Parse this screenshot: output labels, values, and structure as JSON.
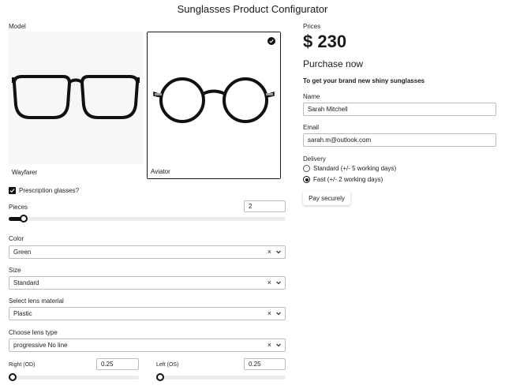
{
  "title": "Sunglasses Product Configurator",
  "model": {
    "label": "Model",
    "options": [
      {
        "name": "Wayfarer",
        "selected": false
      },
      {
        "name": "Aviator",
        "selected": true
      }
    ]
  },
  "prescription": {
    "label": "Prescription glasses?",
    "checked": true
  },
  "pieces": {
    "label": "Pieces",
    "value": "2",
    "slider_fraction": 0.05
  },
  "color": {
    "label": "Color",
    "value": "Green"
  },
  "size": {
    "label": "Size",
    "value": "Standard"
  },
  "lens_material": {
    "label": "Select lens material",
    "value": "Plastic"
  },
  "lens_type": {
    "label": "Choose lens type",
    "value": "progressive No line"
  },
  "right_od": {
    "label": "Right (OD)",
    "value": "0.25",
    "slider_fraction": 0.0
  },
  "left_os": {
    "label": "Left (OS)",
    "value": "0.25",
    "slider_fraction": 0.0
  },
  "prices": {
    "label": "Prices",
    "value": "$ 230"
  },
  "purchase": {
    "heading": "Purchase now",
    "subtitle": "To get your brand new shiny sunglasses"
  },
  "name": {
    "label": "Name",
    "value": "Sarah Mitchell"
  },
  "email": {
    "label": "Email",
    "value": "sarah.m@outlook.com"
  },
  "delivery": {
    "label": "Delivery",
    "options": [
      {
        "label": "Standard (+/- 5 working days)",
        "selected": false
      },
      {
        "label": "Fast (+/- 2 working days)",
        "selected": true
      }
    ]
  },
  "pay_button": "Pay securely",
  "icons": {
    "clear": "×",
    "chevron": "chevron-down-icon",
    "check": "check-icon"
  }
}
